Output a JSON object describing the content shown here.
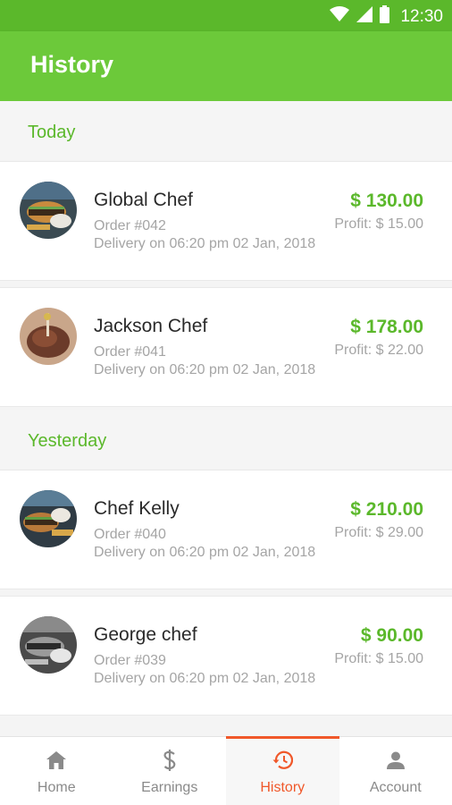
{
  "status_bar": {
    "time": "12:30",
    "icons": [
      "wifi-icon",
      "signal-icon",
      "battery-icon"
    ]
  },
  "app_bar": {
    "title": "History"
  },
  "sections": [
    {
      "label": "Today",
      "orders": [
        {
          "chef": "Global Chef",
          "order": "Order #042",
          "delivery": "Delivery on 06:20 pm 02 Jan, 2018",
          "price": "$ 130.00",
          "profit": "Profit: $ 15.00"
        },
        {
          "chef": "Jackson Chef",
          "order": "Order #041",
          "delivery": "Delivery on 06:20 pm 02 Jan, 2018",
          "price": "$ 178.00",
          "profit": "Profit: $ 22.00"
        }
      ]
    },
    {
      "label": "Yesterday",
      "orders": [
        {
          "chef": "Chef Kelly",
          "order": "Order #040",
          "delivery": "Delivery on 06:20 pm 02 Jan, 2018",
          "price": "$ 210.00",
          "profit": "Profit: $ 29.00"
        },
        {
          "chef": "George chef",
          "order": "Order #039",
          "delivery": "Delivery on 06:20 pm 02 Jan, 2018",
          "price": "$ 90.00",
          "profit": "Profit: $ 15.00"
        }
      ]
    }
  ],
  "bottom_nav": {
    "items": [
      {
        "label": "Home",
        "icon": "home-icon"
      },
      {
        "label": "Earnings",
        "icon": "dollar-icon"
      },
      {
        "label": "History",
        "icon": "history-icon",
        "active": true
      },
      {
        "label": "Account",
        "icon": "account-icon"
      }
    ]
  },
  "colors": {
    "primary": "#6cc93a",
    "status_bar": "#5bb82b",
    "accent": "#f0582a",
    "price": "#5bb82b",
    "muted": "#a5a5a5"
  }
}
